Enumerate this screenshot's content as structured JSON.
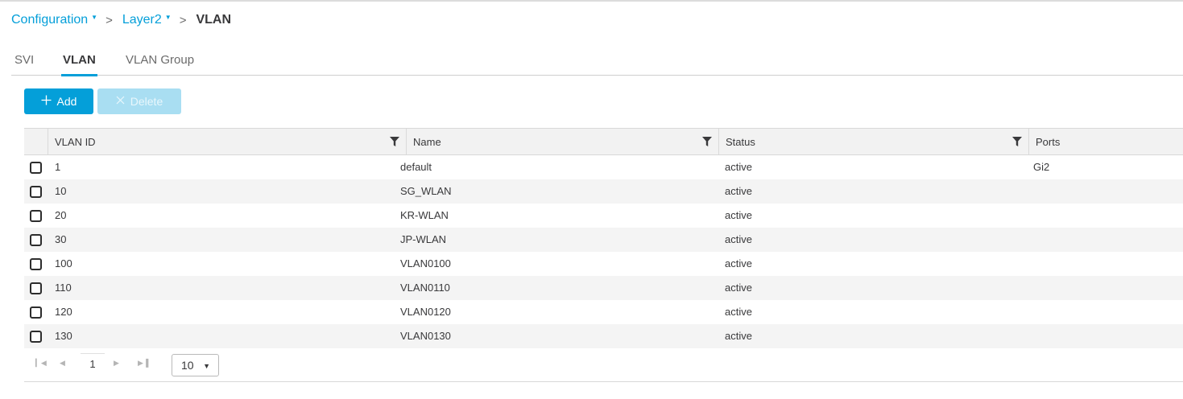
{
  "breadcrumb": {
    "items": [
      {
        "label": "Configuration"
      },
      {
        "label": "Layer2"
      }
    ],
    "separator": ">",
    "current": "VLAN"
  },
  "tabs": [
    {
      "label": "SVI",
      "active": false
    },
    {
      "label": "VLAN",
      "active": true
    },
    {
      "label": "VLAN Group",
      "active": false
    }
  ],
  "toolbar": {
    "add_label": "Add",
    "add_icon": "plus-icon",
    "delete_label": "Delete",
    "delete_icon": "close-icon",
    "delete_enabled": false
  },
  "table": {
    "columns": [
      "VLAN ID",
      "Name",
      "Status",
      "Ports"
    ],
    "rows": [
      {
        "vlan_id": "1",
        "name": "default",
        "status": "active",
        "ports": "Gi2"
      },
      {
        "vlan_id": "10",
        "name": "SG_WLAN",
        "status": "active",
        "ports": ""
      },
      {
        "vlan_id": "20",
        "name": "KR-WLAN",
        "status": "active",
        "ports": ""
      },
      {
        "vlan_id": "30",
        "name": "JP-WLAN",
        "status": "active",
        "ports": ""
      },
      {
        "vlan_id": "100",
        "name": "VLAN0100",
        "status": "active",
        "ports": ""
      },
      {
        "vlan_id": "110",
        "name": "VLAN0110",
        "status": "active",
        "ports": ""
      },
      {
        "vlan_id": "120",
        "name": "VLAN0120",
        "status": "active",
        "ports": ""
      },
      {
        "vlan_id": "130",
        "name": "VLAN0130",
        "status": "active",
        "ports": ""
      }
    ]
  },
  "pager": {
    "current_page": "1",
    "page_size": "10"
  },
  "colors": {
    "accent": "#049fd9",
    "delete_disabled": "#a9def2"
  }
}
